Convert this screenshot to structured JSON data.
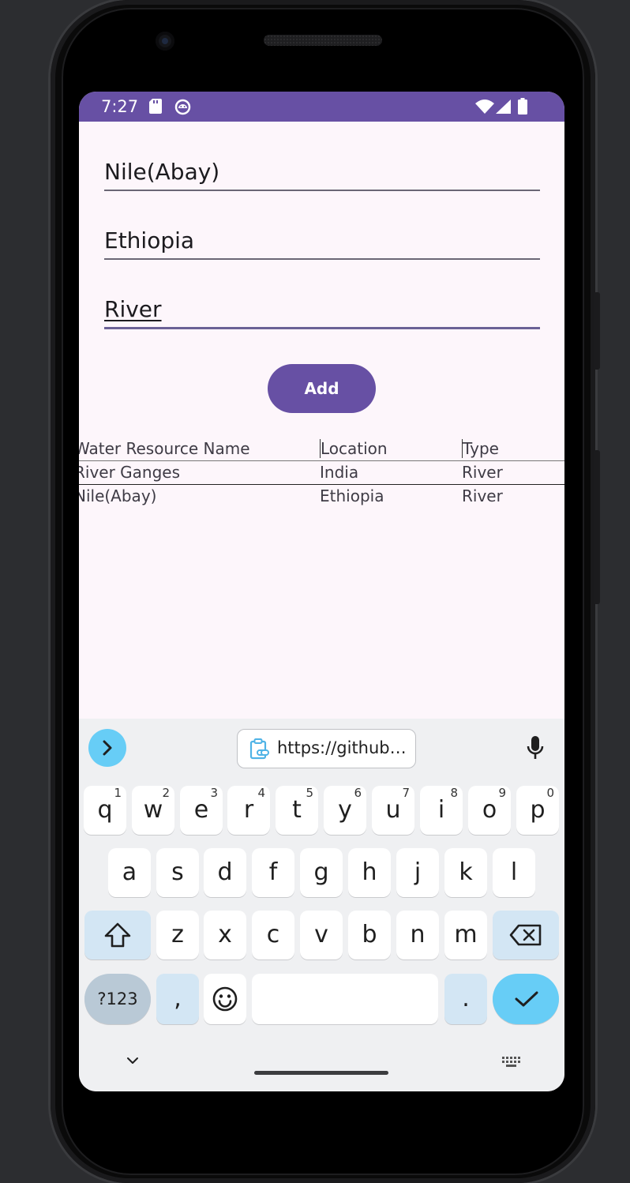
{
  "status_bar": {
    "time": "7:27",
    "background_color": "#6750a4",
    "left_icons": [
      "sd-card-icon",
      "android-debug-icon"
    ],
    "right_icons": [
      "wifi-icon",
      "signal-icon",
      "battery-icon"
    ]
  },
  "form": {
    "name_field_value": "Nile(Abay)",
    "location_field_value": "Ethiopia",
    "type_field_value": "River",
    "add_button_label": "Add",
    "accent_color": "#6750a4"
  },
  "table": {
    "headers": [
      "Water Resource Name",
      "Location",
      "Type"
    ],
    "rows": [
      [
        "River Ganges",
        "India",
        "River"
      ],
      [
        "Nile(Abay)",
        "Ethiopia",
        "River"
      ]
    ]
  },
  "keyboard": {
    "clipboard_suggestion": "https://github…",
    "row1": [
      {
        "key": "q",
        "hint": "1"
      },
      {
        "key": "w",
        "hint": "2"
      },
      {
        "key": "e",
        "hint": "3"
      },
      {
        "key": "r",
        "hint": "4"
      },
      {
        "key": "t",
        "hint": "5"
      },
      {
        "key": "y",
        "hint": "6"
      },
      {
        "key": "u",
        "hint": "7"
      },
      {
        "key": "i",
        "hint": "8"
      },
      {
        "key": "o",
        "hint": "9"
      },
      {
        "key": "p",
        "hint": "0"
      }
    ],
    "row2": [
      "a",
      "s",
      "d",
      "f",
      "g",
      "h",
      "j",
      "k",
      "l"
    ],
    "row3": [
      "z",
      "x",
      "c",
      "v",
      "b",
      "n",
      "m"
    ],
    "symbols_label": "?123",
    "comma_label": ",",
    "period_label": ".",
    "accent_color": "#67cdf6"
  }
}
